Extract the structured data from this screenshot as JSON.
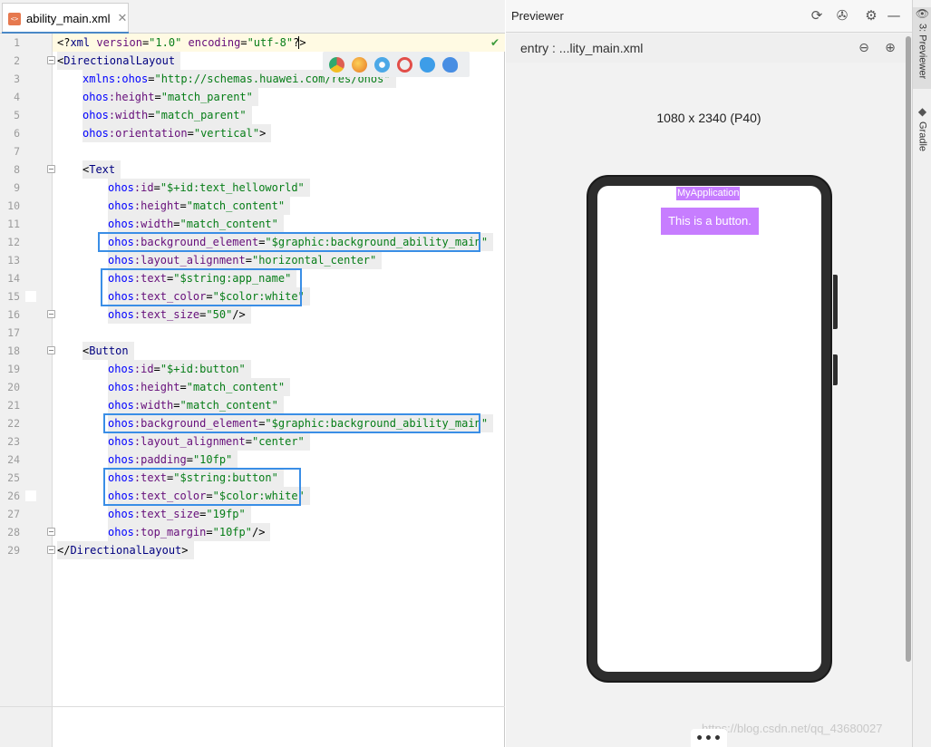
{
  "editor": {
    "tab_label": "ability_main.xml",
    "tab_icon": "xml-file-icon",
    "tab_icon_text": "<>",
    "close_glyph": "✕",
    "lines": [
      {
        "n": "1",
        "parts": [
          [
            "plain",
            "<?"
          ],
          [
            "tag",
            "xml "
          ],
          [
            "attr",
            "version"
          ],
          [
            "plain",
            "="
          ],
          [
            "val",
            "\"1.0\""
          ],
          [
            "plain",
            " "
          ],
          [
            "attr",
            "encoding"
          ],
          [
            "plain",
            "="
          ],
          [
            "val",
            "\"utf-8\""
          ],
          [
            "plain",
            "?>"
          ]
        ]
      },
      {
        "n": "2",
        "parts": [
          [
            "plain",
            "<"
          ],
          [
            "tag",
            "DirectionalLayout"
          ]
        ]
      },
      {
        "n": "3",
        "parts": [
          [
            "nsattr",
            "xmlns:ohos"
          ],
          [
            "plain",
            "="
          ],
          [
            "val",
            "\"http://schemas.huawei.com/res/ohos\""
          ]
        ]
      },
      {
        "n": "4",
        "parts": [
          [
            "nsattr",
            "ohos"
          ],
          [
            "attr",
            ":height"
          ],
          [
            "plain",
            "="
          ],
          [
            "val",
            "\"match_parent\""
          ]
        ]
      },
      {
        "n": "5",
        "parts": [
          [
            "nsattr",
            "ohos"
          ],
          [
            "attr",
            ":width"
          ],
          [
            "plain",
            "="
          ],
          [
            "val",
            "\"match_parent\""
          ]
        ]
      },
      {
        "n": "6",
        "parts": [
          [
            "nsattr",
            "ohos"
          ],
          [
            "attr",
            ":orientation"
          ],
          [
            "plain",
            "="
          ],
          [
            "val",
            "\"vertical\""
          ],
          [
            "plain",
            ">"
          ]
        ]
      },
      {
        "n": "7",
        "parts": []
      },
      {
        "n": "8",
        "parts": [
          [
            "plain",
            "<"
          ],
          [
            "tag",
            "Text"
          ]
        ]
      },
      {
        "n": "9",
        "parts": [
          [
            "nsattr",
            "ohos"
          ],
          [
            "attr",
            ":id"
          ],
          [
            "plain",
            "="
          ],
          [
            "val",
            "\"$+id:text_helloworld\""
          ]
        ]
      },
      {
        "n": "10",
        "parts": [
          [
            "nsattr",
            "ohos"
          ],
          [
            "attr",
            ":height"
          ],
          [
            "plain",
            "="
          ],
          [
            "val",
            "\"match_content\""
          ]
        ]
      },
      {
        "n": "11",
        "parts": [
          [
            "nsattr",
            "ohos"
          ],
          [
            "attr",
            ":width"
          ],
          [
            "plain",
            "="
          ],
          [
            "val",
            "\"match_content\""
          ]
        ]
      },
      {
        "n": "12",
        "parts": [
          [
            "nsattr",
            "ohos"
          ],
          [
            "attr",
            ":background_element"
          ],
          [
            "plain",
            "="
          ],
          [
            "val",
            "\"$graphic:background_ability_main\""
          ]
        ]
      },
      {
        "n": "13",
        "parts": [
          [
            "nsattr",
            "ohos"
          ],
          [
            "attr",
            ":layout_alignment"
          ],
          [
            "plain",
            "="
          ],
          [
            "val",
            "\"horizontal_center\""
          ]
        ]
      },
      {
        "n": "14",
        "parts": [
          [
            "nsattr",
            "ohos"
          ],
          [
            "attr",
            ":text"
          ],
          [
            "plain",
            "="
          ],
          [
            "val",
            "\"$string:app_name\""
          ]
        ]
      },
      {
        "n": "15",
        "parts": [
          [
            "nsattr",
            "ohos"
          ],
          [
            "attr",
            ":text_color"
          ],
          [
            "plain",
            "="
          ],
          [
            "val",
            "\"$color:white\""
          ]
        ]
      },
      {
        "n": "16",
        "parts": [
          [
            "nsattr",
            "ohos"
          ],
          [
            "attr",
            ":text_size"
          ],
          [
            "plain",
            "="
          ],
          [
            "val",
            "\"50\""
          ],
          [
            "plain",
            "/>"
          ]
        ]
      },
      {
        "n": "17",
        "parts": []
      },
      {
        "n": "18",
        "parts": [
          [
            "plain",
            "<"
          ],
          [
            "tag",
            "Button"
          ]
        ]
      },
      {
        "n": "19",
        "parts": [
          [
            "nsattr",
            "ohos"
          ],
          [
            "attr",
            ":id"
          ],
          [
            "plain",
            "="
          ],
          [
            "val",
            "\"$+id:button\""
          ]
        ]
      },
      {
        "n": "20",
        "parts": [
          [
            "nsattr",
            "ohos"
          ],
          [
            "attr",
            ":height"
          ],
          [
            "plain",
            "="
          ],
          [
            "val",
            "\"match_content\""
          ]
        ]
      },
      {
        "n": "21",
        "parts": [
          [
            "nsattr",
            "ohos"
          ],
          [
            "attr",
            ":width"
          ],
          [
            "plain",
            "="
          ],
          [
            "val",
            "\"match_content\""
          ]
        ]
      },
      {
        "n": "22",
        "parts": [
          [
            "nsattr",
            "ohos"
          ],
          [
            "attr",
            ":background_element"
          ],
          [
            "plain",
            "="
          ],
          [
            "val",
            "\"$graphic:background_ability_main\""
          ]
        ]
      },
      {
        "n": "23",
        "parts": [
          [
            "nsattr",
            "ohos"
          ],
          [
            "attr",
            ":layout_alignment"
          ],
          [
            "plain",
            "="
          ],
          [
            "val",
            "\"center\""
          ]
        ]
      },
      {
        "n": "24",
        "parts": [
          [
            "nsattr",
            "ohos"
          ],
          [
            "attr",
            ":padding"
          ],
          [
            "plain",
            "="
          ],
          [
            "val",
            "\"10fp\""
          ]
        ]
      },
      {
        "n": "25",
        "parts": [
          [
            "nsattr",
            "ohos"
          ],
          [
            "attr",
            ":text"
          ],
          [
            "plain",
            "="
          ],
          [
            "val",
            "\"$string:button\""
          ]
        ]
      },
      {
        "n": "26",
        "parts": [
          [
            "nsattr",
            "ohos"
          ],
          [
            "attr",
            ":text_color"
          ],
          [
            "plain",
            "="
          ],
          [
            "val",
            "\"$color:white\""
          ]
        ]
      },
      {
        "n": "27",
        "parts": [
          [
            "nsattr",
            "ohos"
          ],
          [
            "attr",
            ":text_size"
          ],
          [
            "plain",
            "="
          ],
          [
            "val",
            "\"19fp\""
          ]
        ]
      },
      {
        "n": "28",
        "parts": [
          [
            "nsattr",
            "ohos"
          ],
          [
            "attr",
            ":top_margin"
          ],
          [
            "plain",
            "="
          ],
          [
            "val",
            "\"10fp\""
          ],
          [
            "plain",
            "/>"
          ]
        ]
      },
      {
        "n": "29",
        "parts": [
          [
            "plain",
            "</"
          ],
          [
            "tag",
            "DirectionalLayout"
          ],
          [
            "plain",
            ">"
          ]
        ]
      }
    ]
  },
  "preview": {
    "title": "Previewer",
    "entry_label": "entry : ...lity_main.xml",
    "device_size": "1080 x 2340 (P40)",
    "app_title": "MyApplication",
    "app_button": "This is a button.",
    "more_label": "•••",
    "watermark": "https://blog.csdn.net/qq_43680027",
    "app_accent": "#c77dff"
  },
  "tool_strip": {
    "previewer_tab": "3: Previewer",
    "gradle_tab": "Gradle"
  }
}
